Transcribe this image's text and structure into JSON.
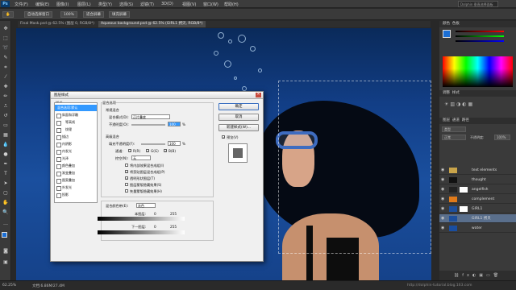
{
  "app": {
    "logo": "Ps"
  },
  "menu": [
    "文件(F)",
    "编辑(E)",
    "图像(I)",
    "图层(L)",
    "类型(Y)",
    "选择(S)",
    "滤镜(T)",
    "3D(D)",
    "视图(V)",
    "窗口(W)",
    "帮助(H)"
  ],
  "workspace": "Dolphin 垂直选择面板",
  "options": {
    "auto_select": "自动选择窗口",
    "zoom": "100%",
    "fit_screen": "适合屏幕",
    "fill_screen": "填充屏幕"
  },
  "tabs": [
    "Final Mask.psd @ 62.5% (图层 0, RGB/8*)",
    "Aqueous background.psd @ 62.5% (GIRL1 拷贝, RGB/8*)"
  ],
  "status": {
    "zoom": "62.25%",
    "doc": "文档:6.86M/27.4M",
    "watermark": "http://dolphin-tutorial.blog.163.com"
  },
  "panels": {
    "color_tab": "颜色",
    "swatches_tab": "色板",
    "adjust_tab": "调整",
    "styles_tab": "样式",
    "layers_tab": "图层",
    "channels_tab": "通道",
    "paths_tab": "路径",
    "blend_mode": "正常",
    "opacity_label": "不透明度:",
    "opacity": "100%",
    "kind": "类型"
  },
  "layers": [
    {
      "name": "text elements",
      "thumb": "folder"
    },
    {
      "name": "thought",
      "thumb": "#111111"
    },
    {
      "name": "angelfish",
      "thumb": "#222222"
    },
    {
      "name": "complement",
      "thumb": "#e07a1a"
    },
    {
      "name": "GIRL1",
      "thumb": "#1d4f9c"
    },
    {
      "name": "GIRL1 拷贝",
      "thumb": "#1d4f9c"
    },
    {
      "name": "water",
      "thumb": "#1a4ea0"
    }
  ],
  "dialog": {
    "title": "图层样式",
    "styles_header": "样式",
    "styles": [
      {
        "label": "混合选项:默认",
        "check": false,
        "active": true
      },
      {
        "label": "斜面和浮雕",
        "check": true
      },
      {
        "label": "等高线",
        "check": true,
        "indent": true
      },
      {
        "label": "纹理",
        "check": true,
        "indent": true
      },
      {
        "label": "描边",
        "check": true
      },
      {
        "label": "内阴影",
        "check": true
      },
      {
        "label": "内发光",
        "check": true
      },
      {
        "label": "光泽",
        "check": true
      },
      {
        "label": "颜色叠加",
        "check": true
      },
      {
        "label": "渐变叠加",
        "check": true
      },
      {
        "label": "图案叠加",
        "check": true
      },
      {
        "label": "外发光",
        "check": true
      },
      {
        "label": "投影",
        "check": true
      }
    ],
    "blend_options_title": "混合选项",
    "general_blend": "常规混合",
    "blend_mode_label": "混合模式(D):",
    "blend_mode_value": "正片叠底",
    "opacity_label": "不透明度(O):",
    "opacity_value": "100",
    "percent": "%",
    "advanced_blend": "高级混合",
    "fill_opacity_label": "填充不透明度(F):",
    "fill_opacity_value": "100",
    "channels_label": "通道:",
    "channel_r": "R(R)",
    "channel_g": "G(G)",
    "channel_b": "B(B)",
    "knockout_label": "挖空(N):",
    "knockout_value": "无",
    "adv_options": [
      {
        "label": "将内部效果混合成组(I)",
        "checked": false
      },
      {
        "label": "将剪贴图层混合成组(P)",
        "checked": true
      },
      {
        "label": "透明形状图层(T)",
        "checked": true
      },
      {
        "label": "图层蒙版隐藏效果(S)",
        "checked": false
      },
      {
        "label": "矢量蒙版隐藏效果(H)",
        "checked": false
      }
    ],
    "blend_if_label": "混合颜色带(E):",
    "blend_if_value": "灰色",
    "this_layer": "本图层:",
    "underlying": "下一图层:",
    "min": "0",
    "max": "255",
    "buttons": {
      "ok": "确定",
      "reset": "取消",
      "new_style": "新建样式(W)...",
      "preview": "预览(V)"
    }
  }
}
